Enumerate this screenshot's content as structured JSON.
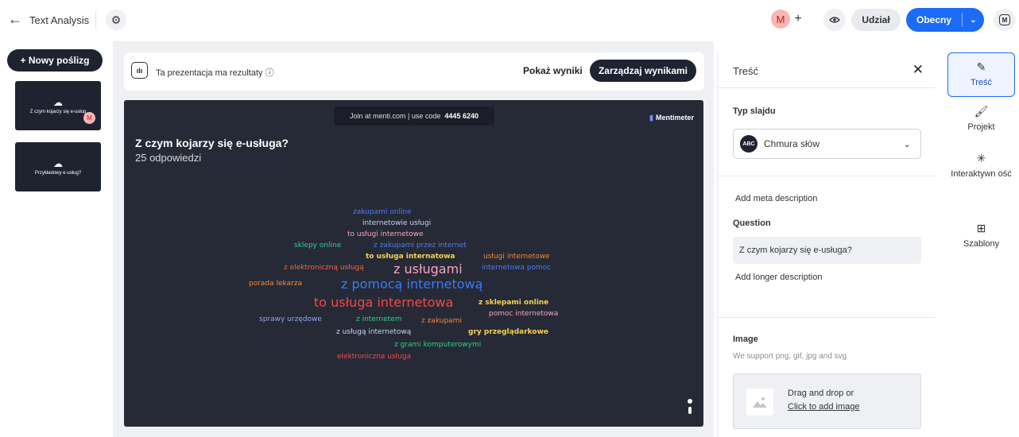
{
  "header": {
    "title": "Text Analysis",
    "collaborator_initial": "M",
    "add_collab_symbol": "+",
    "share_label": "Udział",
    "present_label": "Obecny",
    "logo_letter": "M"
  },
  "sidebar": {
    "new_slide_label": "+ Nowy poślizg",
    "slides": [
      {
        "title": "Z czym kojarzy się e-usług",
        "badge": "M"
      },
      {
        "title": "Przykładowy e-usług?"
      }
    ]
  },
  "results_bar": {
    "icon_text": "ılı",
    "text": "Ta prezentacja ma rezultaty ⓘ",
    "show_label": "Pokaż wyniki",
    "manage_label": "Zarządzaj wynikami"
  },
  "slide": {
    "join_text": "Join at menti.com | use code",
    "join_code": "4445 6240",
    "brand": "Mentimeter",
    "question": "Z czym kojarzy się e-usługa?",
    "responses": "25 odpowiedzi",
    "words": [
      {
        "text": "zakupami online",
        "color": "#4e7cf5"
      },
      {
        "text": "internetowie usługi",
        "color": "#c9d4f2"
      },
      {
        "text": "to usługi internetowe",
        "color": "#f6a5c0"
      },
      {
        "text": "sklepy online",
        "color": "#2dd38a"
      },
      {
        "text": "z zakupami przez internet",
        "color": "#4e7cf5"
      },
      {
        "text": "to usługa internatowa",
        "color": "#f7d154"
      },
      {
        "text": "usługi internetowe",
        "color": "#f0883e"
      },
      {
        "text": "z elektroniczną usługą",
        "color": "#f06449"
      },
      {
        "text": "z usługami",
        "color": "#f6a5c0"
      },
      {
        "text": "internetowa pomoc",
        "color": "#4e7cf5"
      },
      {
        "text": "porada lekarza",
        "color": "#f0883e"
      },
      {
        "text": "z pomocą internetową",
        "color": "#3b7af5"
      },
      {
        "text": "to usługa internetowa",
        "color": "#f04a4a"
      },
      {
        "text": "z sklepami online",
        "color": "#f7d154"
      },
      {
        "text": "pomoc internetowa",
        "color": "#f6a5c0"
      },
      {
        "text": "sprawy urzędowe",
        "color": "#8fa7f5"
      },
      {
        "text": "z internetem",
        "color": "#2dd38a"
      },
      {
        "text": "z zakupami",
        "color": "#f0883e"
      },
      {
        "text": "z usługą internetową",
        "color": "#c9d4f2"
      },
      {
        "text": "gry przeglądarkowe",
        "color": "#f7d154"
      },
      {
        "text": "z grami komputerowymi",
        "color": "#2dd38a"
      },
      {
        "text": "elektroniczna usługa",
        "color": "#f04a4a"
      }
    ]
  },
  "panel": {
    "title": "Treść",
    "slide_type_label": "Typ slajdu",
    "slide_type_icon_text": "ABC",
    "slide_type_value": "Chmura słów",
    "meta_link": "Add meta description",
    "question_label": "Question",
    "question_value": "Z czym kojarzy się e-usługa?",
    "longer_link": "Add longer description",
    "image_label": "Image",
    "image_support": "We support png, gif, jpg and svg",
    "drop_text": "Drag and drop or",
    "click_text": "Click to add image"
  },
  "right_tabs": [
    {
      "label": "Treść",
      "icon": "pencil-icon"
    },
    {
      "label": "Projekt",
      "icon": "brush-icon"
    },
    {
      "label": "Interaktywn ość",
      "icon": "interactivity-icon"
    },
    {
      "label": "Szablony",
      "icon": "templates-icon"
    }
  ],
  "colors": {
    "accent": "#1b6bf7",
    "dark": "#1f2330",
    "slide_bg": "#262a36"
  }
}
